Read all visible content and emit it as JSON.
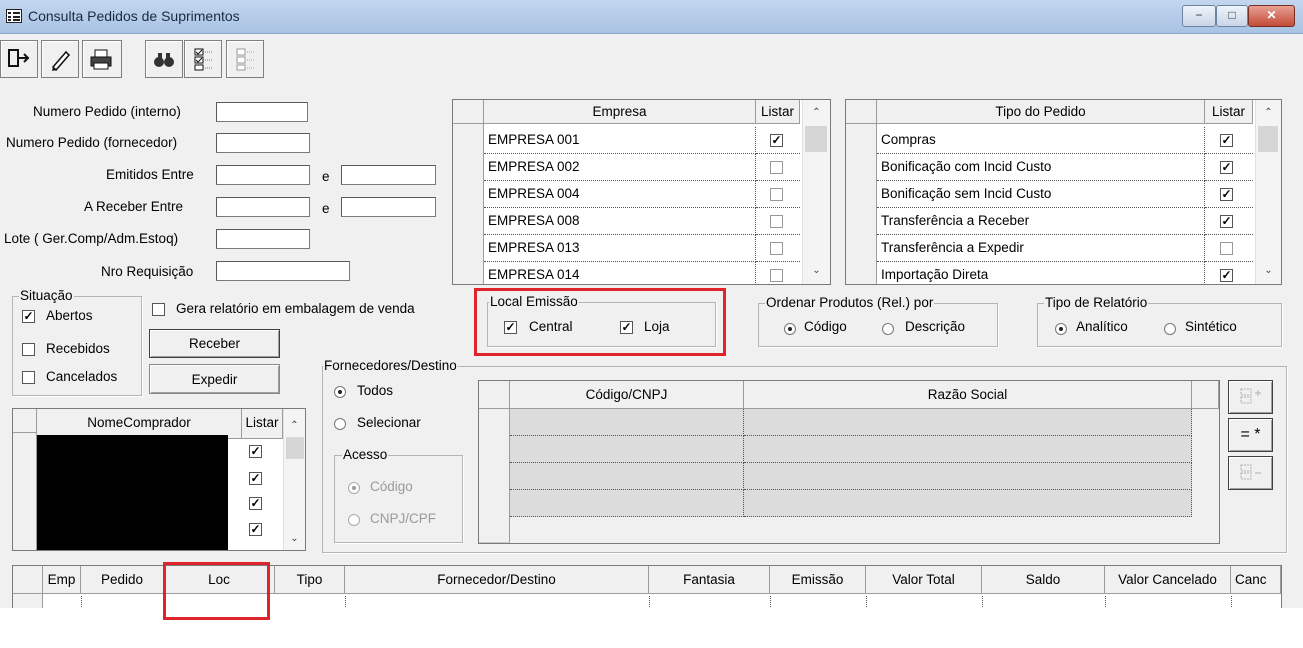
{
  "window": {
    "title": "Consulta Pedidos de Suprimentos",
    "minimize": "−",
    "maximize": "□",
    "close": "✕"
  },
  "toolbar": {
    "icons": [
      "exit-icon",
      "edit-icon",
      "print-icon",
      "find-icon",
      "list-check-icon",
      "list-icon"
    ]
  },
  "form": {
    "numero_interno": {
      "label": "Numero Pedido (interno)",
      "value": ""
    },
    "numero_fornecedor": {
      "label": "Numero Pedido (fornecedor)",
      "value": ""
    },
    "emitidos": {
      "label": "Emitidos Entre",
      "e": "e",
      "from": "",
      "to": ""
    },
    "receber": {
      "label": "A Receber Entre",
      "e": "e",
      "from": "",
      "to": ""
    },
    "lote": {
      "label": "Lote ( Ger.Comp/Adm.Estoq)",
      "value": ""
    },
    "requisicao": {
      "label": "Nro Requisição",
      "value": ""
    }
  },
  "situacao": {
    "title": "Situação",
    "items": [
      {
        "label": "Abertos",
        "checked": "✓"
      },
      {
        "label": "Recebidos",
        "checked": ""
      },
      {
        "label": "Cancelados",
        "checked": ""
      }
    ]
  },
  "gera_relatorio": {
    "label": "Gera relatório em embalagem de venda",
    "checked": ""
  },
  "buttons": {
    "receber": "Receber",
    "expedir": "Expedir"
  },
  "empresa_grid": {
    "headers": {
      "empresa": "Empresa",
      "listar": "Listar"
    },
    "rows": [
      {
        "name": "EMPRESA 001",
        "check": "✓"
      },
      {
        "name": "EMPRESA 002",
        "check": ""
      },
      {
        "name": "EMPRESA 004",
        "check": ""
      },
      {
        "name": "EMPRESA 008",
        "check": ""
      },
      {
        "name": "EMPRESA 013",
        "check": ""
      },
      {
        "name": "EMPRESA 014",
        "check": ""
      }
    ]
  },
  "tipo_grid": {
    "headers": {
      "tipo": "Tipo do Pedido",
      "listar": "Listar"
    },
    "rows": [
      {
        "name": "Compras",
        "check": "✓"
      },
      {
        "name": "Bonificação com Incid Custo",
        "check": "✓"
      },
      {
        "name": "Bonificação sem Incid Custo",
        "check": "✓"
      },
      {
        "name": "Transferência a Receber",
        "check": "✓"
      },
      {
        "name": "Transferência a Expedir",
        "check": ""
      },
      {
        "name": "Importação Direta",
        "check": "✓"
      }
    ]
  },
  "local_emissao": {
    "title": "Local Emissão",
    "central": "Central",
    "loja": "Loja",
    "central_check": "✓",
    "loja_check": "✓"
  },
  "ordenar": {
    "title": "Ordenar Produtos (Rel.) por",
    "codigo": "Código",
    "descricao": "Descrição"
  },
  "tipo_relatorio": {
    "title": "Tipo de Relatório",
    "analitico": "Analítico",
    "sintetico": "Sintético"
  },
  "fornecedores": {
    "title": "Fornecedores/Destino",
    "todos": "Todos",
    "selecionar": "Selecionar",
    "acesso": {
      "title": "Acesso",
      "codigo": "Código",
      "cnpj": "CNPJ/CPF"
    },
    "headers": {
      "codigo": "Código/CNPJ",
      "razao": "Razão Social"
    },
    "side_buttons": [
      "add-rows-icon",
      "= *",
      "remove-rows-icon"
    ]
  },
  "comprador_grid": {
    "headers": {
      "nome": "NomeComprador",
      "listar": "Listar"
    },
    "rows": [
      {
        "check": "✓"
      },
      {
        "check": "✓"
      },
      {
        "check": "✓"
      },
      {
        "check": "✓"
      }
    ]
  },
  "pedidos_grid": {
    "headers": [
      "Emp",
      "Pedido",
      "Loc",
      "Tipo",
      "Fornecedor/Destino",
      "Fantasia",
      "Emissão",
      "Valor Total",
      "Saldo",
      "Valor Cancelado",
      "Canc"
    ]
  },
  "colors": {
    "highlight": "#e0242c",
    "titlebar": "#b5cbe8"
  }
}
